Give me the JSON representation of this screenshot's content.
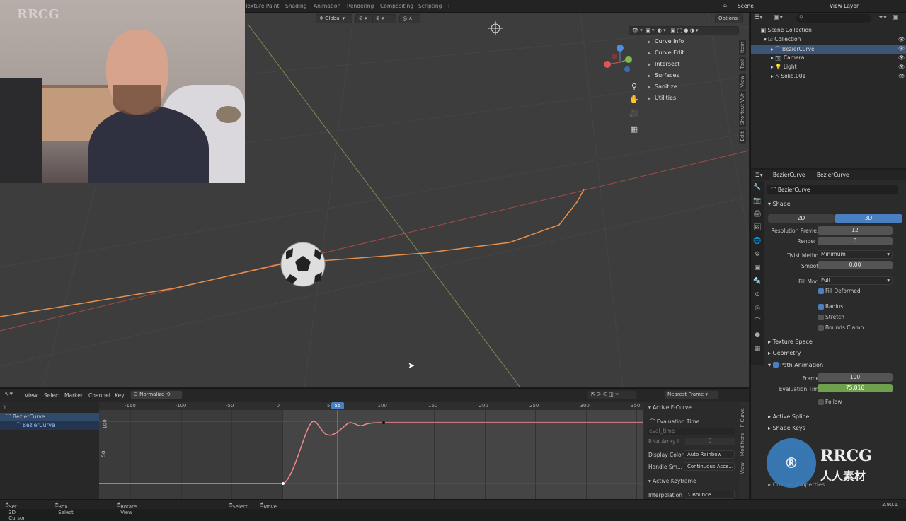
{
  "topbar": {
    "tabs": [
      "Texture Paint",
      "Shading",
      "Animation",
      "Rendering",
      "Compositing",
      "Scripting",
      "+"
    ],
    "scene_label": "Scene",
    "view_layer_label": "View Layer"
  },
  "viewport": {
    "transform_orientation": "Global",
    "options_label": "Options",
    "menus": [
      "Curve Info",
      "Curve Edit",
      "Intersect",
      "Surfaces",
      "Sanitize",
      "Utilities"
    ],
    "side_tabs": [
      "Item",
      "Tool",
      "View",
      "Shortcut VUr",
      "Edit"
    ]
  },
  "outliner": {
    "scene_collection": "Scene Collection",
    "items": [
      {
        "label": "Collection",
        "indent": 0
      },
      {
        "label": "BezierCurve",
        "indent": 1,
        "selected": true
      },
      {
        "label": "Camera",
        "indent": 1
      },
      {
        "label": "Light",
        "indent": 1
      },
      {
        "label": "Solid.001",
        "indent": 1
      }
    ]
  },
  "properties": {
    "breadcrumb_object": "BezierCurve",
    "breadcrumb_data": "BezierCurve",
    "datablock_name": "BezierCurve",
    "shape_header": "Shape",
    "dim_2d": "2D",
    "dim_3d": "3D",
    "resolution_preview_label": "Resolution Previe...",
    "resolution_preview_value": "12",
    "render_u_label": "Render U",
    "render_u_value": "0",
    "twist_method_label": "Twist Method",
    "twist_method_value": "Minimum",
    "smooth_label": "Smooth",
    "smooth_value": "0.00",
    "fill_mode_label": "Fill Mode",
    "fill_mode_value": "Full",
    "fill_deformed": "Fill Deformed",
    "radius": "Radius",
    "stretch": "Stretch",
    "bounds_clamp": "Bounds Clamp",
    "texture_space": "Texture Space",
    "geometry": "Geometry",
    "path_animation": "Path Animation",
    "frames_label": "Frames",
    "frames_value": "100",
    "evaluation_time_label": "Evaluation Time",
    "evaluation_time_value": "75.016",
    "follow": "Follow",
    "active_spline": "Active Spline",
    "shape_keys": "Shape Keys",
    "custom_properties": "Custom Properties"
  },
  "graph_editor": {
    "menus": [
      "View",
      "Select",
      "Marker",
      "Channel",
      "Key"
    ],
    "normalize": "Normalize",
    "snap": "Nearest Frame",
    "channels": [
      "BezierCurve",
      "BezierCurve"
    ],
    "frame_ticks": [
      "-150",
      "-100",
      "-50",
      "0",
      "50",
      "100",
      "150",
      "200",
      "250",
      "300",
      "350"
    ],
    "current_frame": "55",
    "value_ticks": [
      "100",
      "50"
    ],
    "sidebar": {
      "active_fcurve": "Active F-Curve",
      "evaluation_time": "Evaluation Time",
      "eval_time": "eval_time",
      "rna_array_label": "RNA Array I...",
      "rna_array_value": "0",
      "display_color_label": "Display Color",
      "display_color_value": "Auto Rainbow",
      "handle_label": "Handle Sm...",
      "handle_value": "Continuous Acce...",
      "active_keyframe": "Active Keyframe",
      "interpolation_label": "Interpolation",
      "interpolation_value": "Bounce"
    },
    "side_tabs": [
      "F-Curve",
      "Modifiers",
      "View"
    ]
  },
  "statusbar": {
    "items": [
      "Set 3D Cursor",
      "Box Select",
      "Rotate View",
      "Select",
      "Move"
    ],
    "version": "2.90.1"
  },
  "watermarks": {
    "brand": "RRCG",
    "cn": "人人素材"
  }
}
